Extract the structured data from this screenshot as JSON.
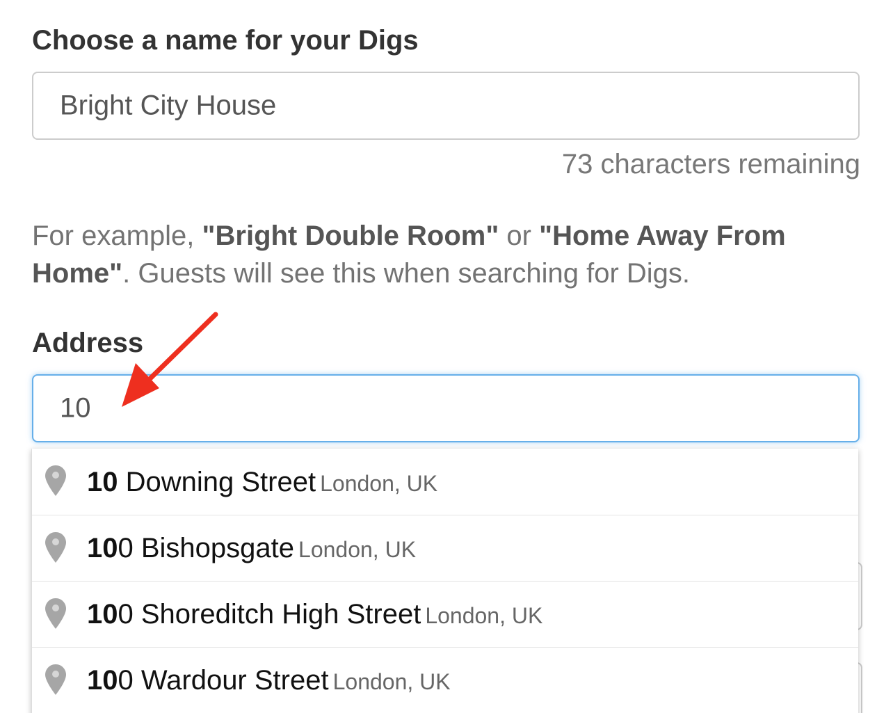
{
  "name_section": {
    "label": "Choose a name for your Digs",
    "value": "Bright City House",
    "remaining": "73 characters remaining"
  },
  "help": {
    "prefix": "For example, ",
    "example1": "\"Bright Double Room\"",
    "middle": " or ",
    "example2": "\"Home Away From Home\"",
    "suffix": ". Guests will see this when searching for Digs."
  },
  "address_section": {
    "label": "Address",
    "value": "10"
  },
  "suggestions": [
    {
      "match": "10",
      "rest": " Downing Street",
      "city": "London, UK"
    },
    {
      "match": "10",
      "rest": "0 Bishopsgate",
      "city": "London, UK"
    },
    {
      "match": "10",
      "rest": "0 Shoreditch High Street",
      "city": "London, UK"
    },
    {
      "match": "10",
      "rest": "0 Wardour Street",
      "city": "London, UK"
    }
  ],
  "colors": {
    "focus_border": "#66afe9",
    "arrow": "#ee2f1f",
    "pin": "#999999"
  },
  "icons": {
    "suggestion": "map-pin-icon",
    "annotation": "red-arrow"
  }
}
